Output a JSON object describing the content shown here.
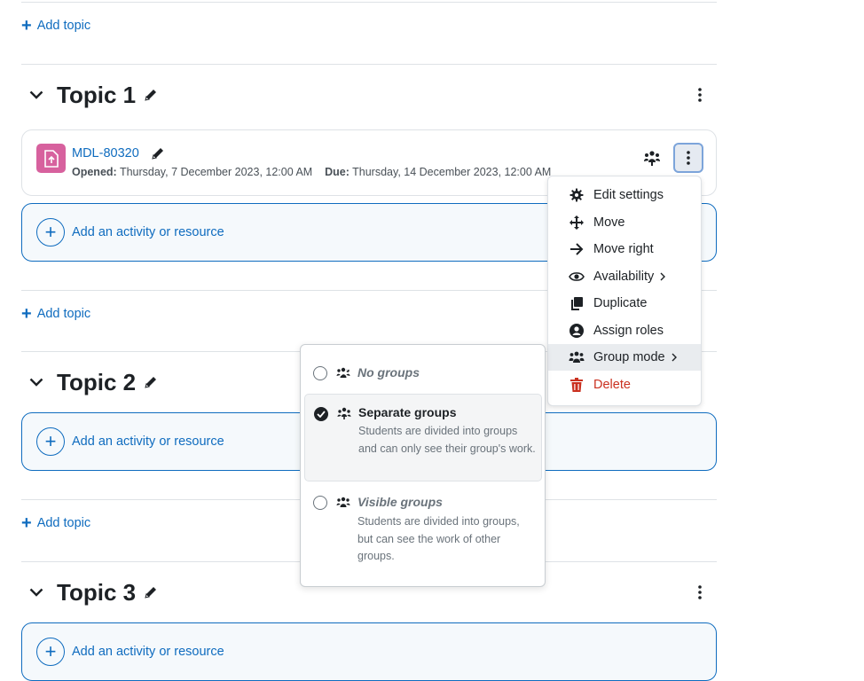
{
  "add_topic_label": "Add topic",
  "add_activity_label": "Add an activity or resource",
  "topics": [
    {
      "title": "Topic 1"
    },
    {
      "title": "Topic 2"
    },
    {
      "title": "Topic 3"
    }
  ],
  "activity": {
    "name": "MDL-80320",
    "opened_label": "Opened:",
    "opened_value": "Thursday, 7 December 2023, 12:00 AM",
    "due_label": "Due:",
    "due_value": "Thursday, 14 December 2023, 12:00 AM",
    "icon_color": "#d7619e"
  },
  "action_menu": {
    "items": [
      {
        "label": "Edit settings",
        "icon": "gear-icon"
      },
      {
        "label": "Move",
        "icon": "move-arrows-icon"
      },
      {
        "label": "Move right",
        "icon": "arrow-right-icon"
      },
      {
        "label": "Availability",
        "icon": "eye-icon",
        "submenu": true
      },
      {
        "label": "Duplicate",
        "icon": "copy-icon"
      },
      {
        "label": "Assign roles",
        "icon": "user-circle-icon"
      },
      {
        "label": "Group mode",
        "icon": "group-icon",
        "submenu": true,
        "active": true
      },
      {
        "label": "Delete",
        "icon": "trash-icon",
        "danger": true
      }
    ]
  },
  "group_mode_popover": {
    "options": [
      {
        "title": "No groups",
        "description": "",
        "selected": false
      },
      {
        "title": "Separate groups",
        "description": "Students are divided into groups and can only see their group's work.",
        "selected": true
      },
      {
        "title": "Visible groups",
        "description": "Students are divided into groups, but can see the work of other groups.",
        "selected": false
      }
    ]
  },
  "colors": {
    "link": "#0f6cbf",
    "danger": "#ca3120",
    "text": "#1d2125",
    "muted": "#6a737b"
  }
}
